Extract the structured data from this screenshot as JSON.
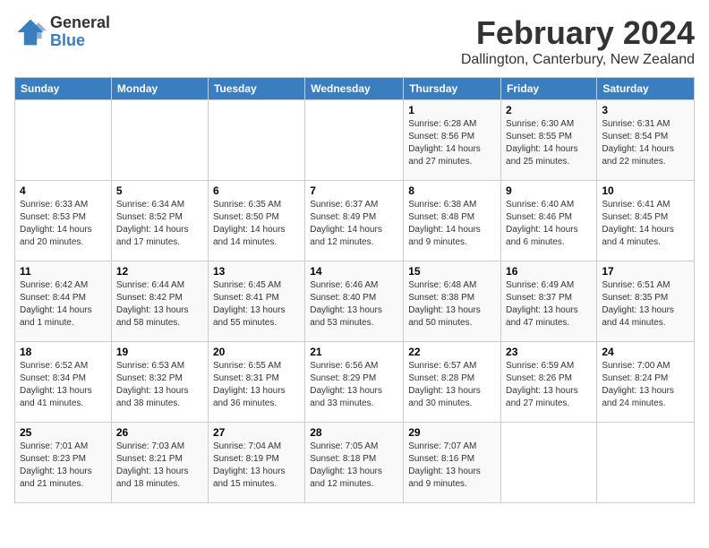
{
  "logo": {
    "general": "General",
    "blue": "Blue"
  },
  "title": "February 2024",
  "location": "Dallington, Canterbury, New Zealand",
  "days_of_week": [
    "Sunday",
    "Monday",
    "Tuesday",
    "Wednesday",
    "Thursday",
    "Friday",
    "Saturday"
  ],
  "weeks": [
    [
      {
        "day": "",
        "info": ""
      },
      {
        "day": "",
        "info": ""
      },
      {
        "day": "",
        "info": ""
      },
      {
        "day": "",
        "info": ""
      },
      {
        "day": "1",
        "info": "Sunrise: 6:28 AM\nSunset: 8:56 PM\nDaylight: 14 hours and 27 minutes."
      },
      {
        "day": "2",
        "info": "Sunrise: 6:30 AM\nSunset: 8:55 PM\nDaylight: 14 hours and 25 minutes."
      },
      {
        "day": "3",
        "info": "Sunrise: 6:31 AM\nSunset: 8:54 PM\nDaylight: 14 hours and 22 minutes."
      }
    ],
    [
      {
        "day": "4",
        "info": "Sunrise: 6:33 AM\nSunset: 8:53 PM\nDaylight: 14 hours and 20 minutes."
      },
      {
        "day": "5",
        "info": "Sunrise: 6:34 AM\nSunset: 8:52 PM\nDaylight: 14 hours and 17 minutes."
      },
      {
        "day": "6",
        "info": "Sunrise: 6:35 AM\nSunset: 8:50 PM\nDaylight: 14 hours and 14 minutes."
      },
      {
        "day": "7",
        "info": "Sunrise: 6:37 AM\nSunset: 8:49 PM\nDaylight: 14 hours and 12 minutes."
      },
      {
        "day": "8",
        "info": "Sunrise: 6:38 AM\nSunset: 8:48 PM\nDaylight: 14 hours and 9 minutes."
      },
      {
        "day": "9",
        "info": "Sunrise: 6:40 AM\nSunset: 8:46 PM\nDaylight: 14 hours and 6 minutes."
      },
      {
        "day": "10",
        "info": "Sunrise: 6:41 AM\nSunset: 8:45 PM\nDaylight: 14 hours and 4 minutes."
      }
    ],
    [
      {
        "day": "11",
        "info": "Sunrise: 6:42 AM\nSunset: 8:44 PM\nDaylight: 14 hours and 1 minute."
      },
      {
        "day": "12",
        "info": "Sunrise: 6:44 AM\nSunset: 8:42 PM\nDaylight: 13 hours and 58 minutes."
      },
      {
        "day": "13",
        "info": "Sunrise: 6:45 AM\nSunset: 8:41 PM\nDaylight: 13 hours and 55 minutes."
      },
      {
        "day": "14",
        "info": "Sunrise: 6:46 AM\nSunset: 8:40 PM\nDaylight: 13 hours and 53 minutes."
      },
      {
        "day": "15",
        "info": "Sunrise: 6:48 AM\nSunset: 8:38 PM\nDaylight: 13 hours and 50 minutes."
      },
      {
        "day": "16",
        "info": "Sunrise: 6:49 AM\nSunset: 8:37 PM\nDaylight: 13 hours and 47 minutes."
      },
      {
        "day": "17",
        "info": "Sunrise: 6:51 AM\nSunset: 8:35 PM\nDaylight: 13 hours and 44 minutes."
      }
    ],
    [
      {
        "day": "18",
        "info": "Sunrise: 6:52 AM\nSunset: 8:34 PM\nDaylight: 13 hours and 41 minutes."
      },
      {
        "day": "19",
        "info": "Sunrise: 6:53 AM\nSunset: 8:32 PM\nDaylight: 13 hours and 38 minutes."
      },
      {
        "day": "20",
        "info": "Sunrise: 6:55 AM\nSunset: 8:31 PM\nDaylight: 13 hours and 36 minutes."
      },
      {
        "day": "21",
        "info": "Sunrise: 6:56 AM\nSunset: 8:29 PM\nDaylight: 13 hours and 33 minutes."
      },
      {
        "day": "22",
        "info": "Sunrise: 6:57 AM\nSunset: 8:28 PM\nDaylight: 13 hours and 30 minutes."
      },
      {
        "day": "23",
        "info": "Sunrise: 6:59 AM\nSunset: 8:26 PM\nDaylight: 13 hours and 27 minutes."
      },
      {
        "day": "24",
        "info": "Sunrise: 7:00 AM\nSunset: 8:24 PM\nDaylight: 13 hours and 24 minutes."
      }
    ],
    [
      {
        "day": "25",
        "info": "Sunrise: 7:01 AM\nSunset: 8:23 PM\nDaylight: 13 hours and 21 minutes."
      },
      {
        "day": "26",
        "info": "Sunrise: 7:03 AM\nSunset: 8:21 PM\nDaylight: 13 hours and 18 minutes."
      },
      {
        "day": "27",
        "info": "Sunrise: 7:04 AM\nSunset: 8:19 PM\nDaylight: 13 hours and 15 minutes."
      },
      {
        "day": "28",
        "info": "Sunrise: 7:05 AM\nSunset: 8:18 PM\nDaylight: 13 hours and 12 minutes."
      },
      {
        "day": "29",
        "info": "Sunrise: 7:07 AM\nSunset: 8:16 PM\nDaylight: 13 hours and 9 minutes."
      },
      {
        "day": "",
        "info": ""
      },
      {
        "day": "",
        "info": ""
      }
    ]
  ]
}
